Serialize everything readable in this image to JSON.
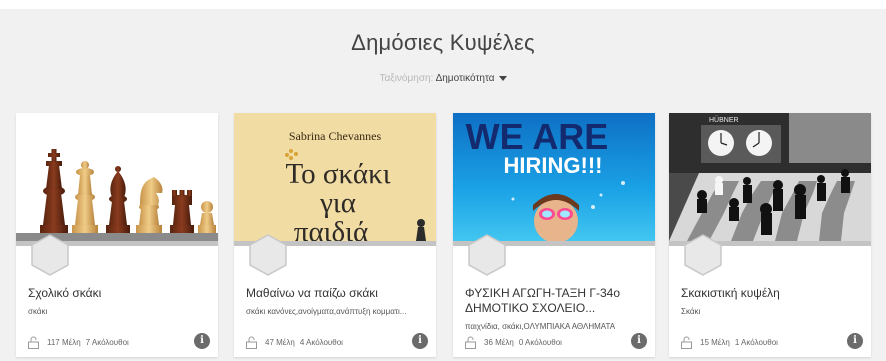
{
  "page": {
    "title": "Δημόσιες Κυψέλες",
    "sort_label": "Ταξινόμηση:",
    "sort_value": "Δημοτικότητα"
  },
  "colors": {
    "background": "#f1f1f1",
    "card": "#ffffff",
    "info_badge": "#6b6b6b"
  },
  "cards": [
    {
      "title": "Σχολικό σκάκι",
      "tags": "σκάκι",
      "members": "117 Μέλη",
      "followers": "7 Ακόλουθοι",
      "image": "chess-pieces"
    },
    {
      "title": "Μαθαίνω να παίζω σκάκι",
      "tags": "σκάκι κανόνες,ανοίγματα,ανάπτυξη κομματι...",
      "members": "47 Μέλη",
      "followers": "4 Ακόλουθοι",
      "image": "book-cover",
      "image_text": {
        "author": "Sabrina Chevannes",
        "line1": "Το σκάκι",
        "line2": "για",
        "line3": "παιδιά"
      }
    },
    {
      "title": "ΦΥΣΙΚΗ ΑΓΩΓΗ-ΤΑΞΗ Γ-34ο ΔΗΜΟΤΙΚΟ ΣΧΟΛΕΙΟ...",
      "tags": "παιχνίδια, σκάκι,ΟΛΥΜΠΙΑΚΑ ΑΘΛΗΜΑΤΑ",
      "members": "36 Μέλη",
      "followers": "0 Ακόλουθοι",
      "image": "hiring-poster",
      "image_text": {
        "line1": "WE ARE",
        "line2": "HIRING!!!"
      }
    },
    {
      "title": "Σκακιστική κυψέλη",
      "tags": "Σκάκι",
      "members": "15 Μέλη",
      "followers": "1 Ακόλουθοι",
      "image": "chess-board-photo",
      "image_text": {
        "brand": "HÜBNER"
      }
    }
  ],
  "icons": {
    "lock": "lock-icon",
    "info": "info-icon",
    "hex": "hexagon-avatar-icon",
    "caret": "caret-down-icon"
  },
  "info_glyph": "i"
}
